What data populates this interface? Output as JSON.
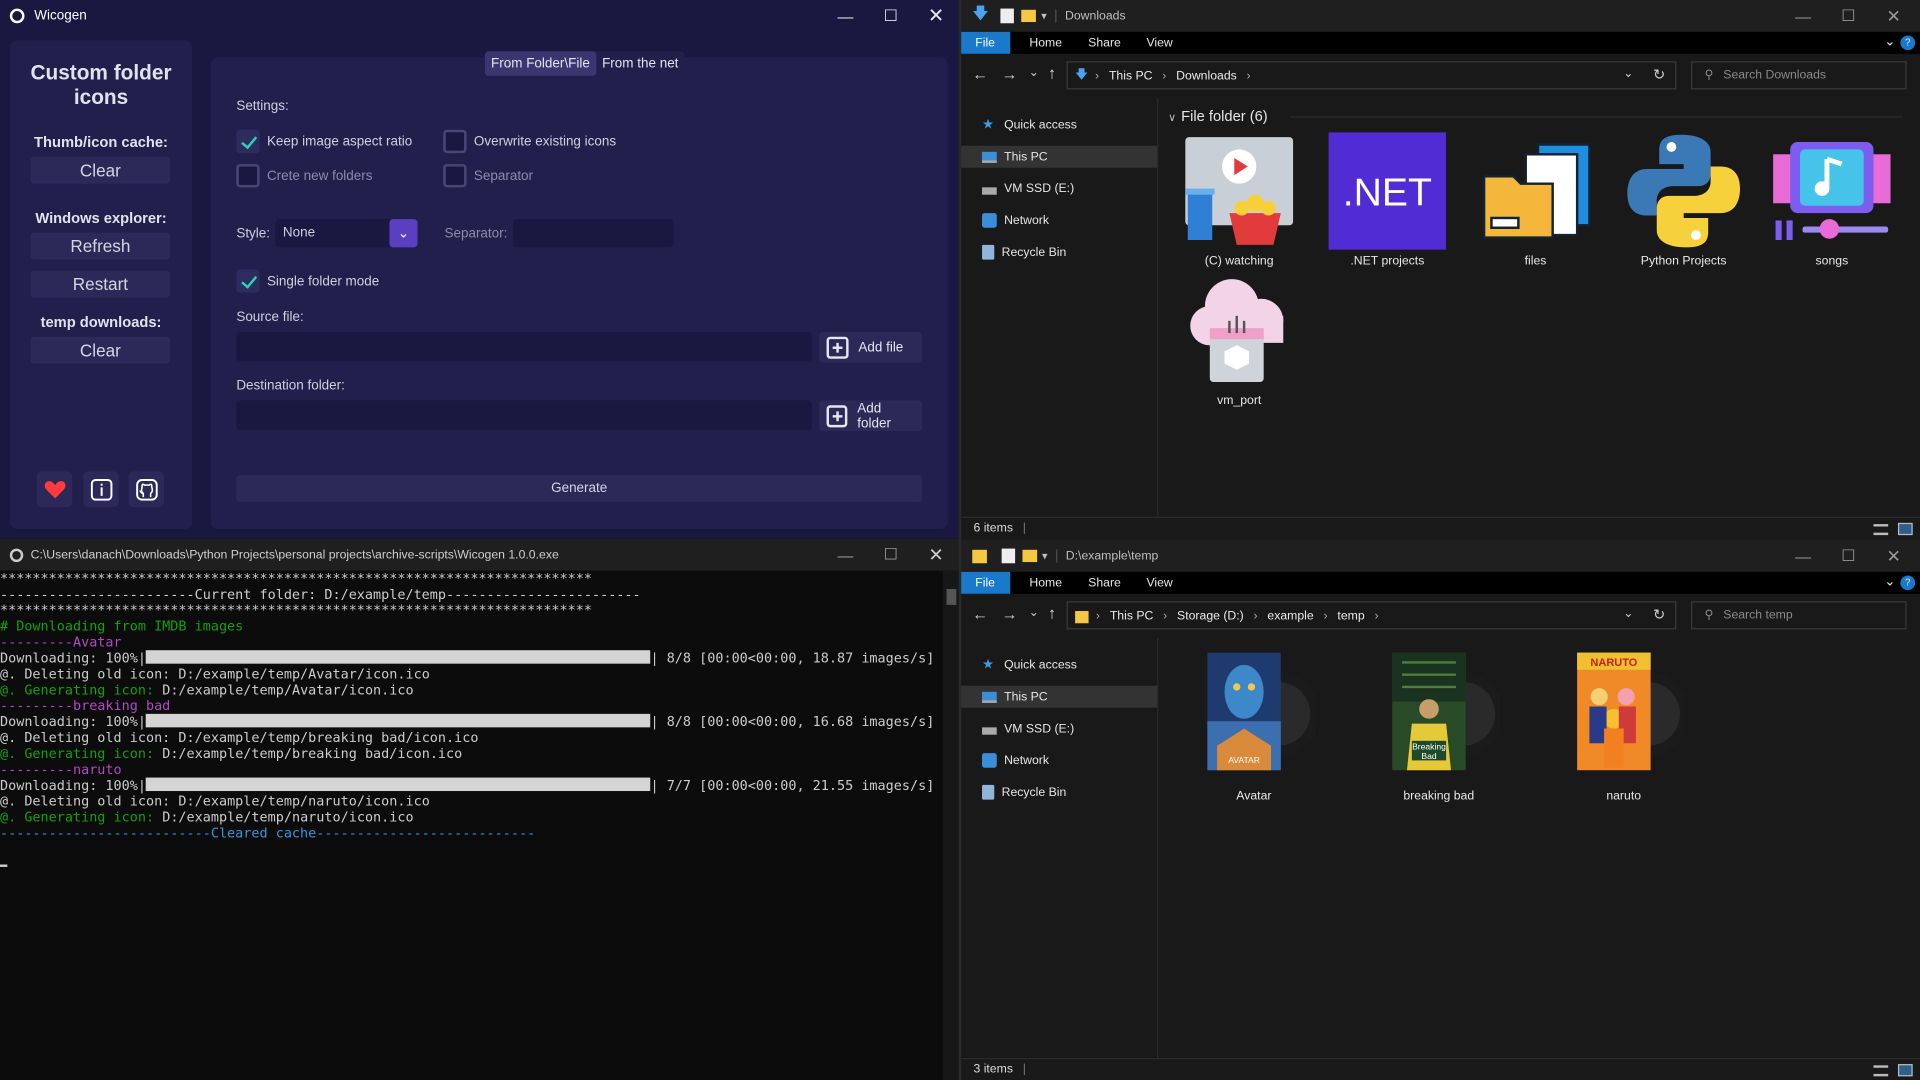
{
  "wicogen": {
    "title": "Wicogen",
    "sidebar": {
      "heading": "Custom folder icons",
      "thumb_label": "Thumb/icon cache:",
      "clear1": "Clear",
      "explorer_label": "Windows explorer:",
      "refresh": "Refresh",
      "restart": "Restart",
      "temp_label": "temp downloads:",
      "clear2": "Clear"
    },
    "tabs": [
      "From Folder\\File",
      "From the net"
    ],
    "settings_label": "Settings:",
    "keep_ratio": "Keep image aspect ratio",
    "overwrite": "Overwrite existing icons",
    "crete_folders": "Crete new folders",
    "separator_cb": "Separator",
    "style_label": "Style:",
    "style_value": "None",
    "separator_label": "Separator:",
    "single_mode": "Single folder mode",
    "source_label": "Source file:",
    "add_file": "Add file",
    "dest_label": "Destination folder:",
    "add_folder": "Add folder",
    "generate": "Generate",
    "checks": {
      "keep_ratio": true,
      "overwrite": false,
      "crete_folders": false,
      "separator": false,
      "single_mode": true
    },
    "accent": "#2ed2b2"
  },
  "console": {
    "title": "C:\\Users\\danach\\Downloads\\Python Projects\\personal projects\\archive-scripts\\Wicogen 1.0.0.exe",
    "lines": {
      "stars": "*************************************************************************",
      "current": "------------------------Current folder: D:/example/temp------------------------",
      "dl_header": "# Downloading from IMDB images",
      "sec1": "---------Avatar",
      "dl1a": "Downloading: 100%|",
      "dl1b": "| 8/8 [00:00<00:00, 18.87 images/s]",
      "del1a": "@. Deleting old icon:",
      "del1b": " D:/example/temp/Avatar/icon.ico",
      "gen1a": "@. Generating icon:",
      "gen1b": " D:/example/temp/Avatar/icon.ico",
      "sec2": "---------breaking bad",
      "dl2b": "| 8/8 [00:00<00:00, 16.68 images/s]",
      "del2b": " D:/example/temp/breaking bad/icon.ico",
      "gen2b": " D:/example/temp/breaking bad/icon.ico",
      "sec3": "---------naruto",
      "dl3b": "| 7/7 [00:00<00:00, 21.55 images/s]",
      "del3b": " D:/example/temp/naruto/icon.ico",
      "gen3b": " D:/example/temp/naruto/icon.ico",
      "cleared": "--------------------------Cleared cache---------------------------"
    }
  },
  "explorer_top": {
    "title": "Downloads",
    "ribbon": [
      "File",
      "Home",
      "Share",
      "View"
    ],
    "crumbs": [
      "This PC",
      "Downloads"
    ],
    "search": "Search Downloads",
    "nav": [
      "Quick access",
      "This PC",
      "VM SSD (E:)",
      "Network",
      "Recycle Bin"
    ],
    "group": "File folder (6)",
    "items": [
      "(C) watching",
      ".NET projects",
      "files",
      "Python Projects",
      "songs",
      "vm_port"
    ],
    "status": "6 items"
  },
  "explorer_bottom": {
    "title": "D:\\example\\temp",
    "ribbon": [
      "File",
      "Home",
      "Share",
      "View"
    ],
    "crumbs": [
      "This PC",
      "Storage (D:)",
      "example",
      "temp"
    ],
    "search": "Search temp",
    "nav": [
      "Quick access",
      "This PC",
      "VM SSD (E:)",
      "Network",
      "Recycle Bin"
    ],
    "items": [
      "Avatar",
      "breaking bad",
      "naruto"
    ],
    "status": "3 items"
  },
  "colors": {
    "wicogen_bg": "#1a1740",
    "panel": "#221f4c",
    "explorer_file_tab": "#1979ca"
  }
}
